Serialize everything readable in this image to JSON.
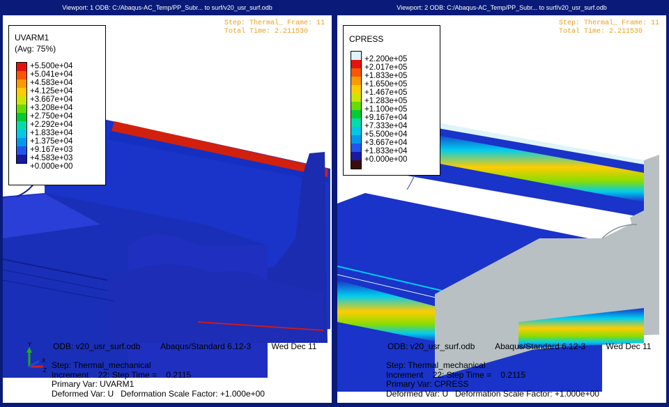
{
  "viewports": [
    {
      "title": "Viewport: 1    ODB: C:/Abaqus-AC_Temp/PP_Subr... to surf/v20_usr_surf.odb",
      "info": {
        "step_line": "Step: Thermal_ Frame: 11",
        "time_line": "Total Time: 2.211530"
      },
      "legend": {
        "title": "UVARM1",
        "subtitle": "(Avg: 75%)",
        "values": [
          "+5.500e+04",
          "+5.041e+04",
          "+4.583e+04",
          "+4.125e+04",
          "+3.667e+04",
          "+3.208e+04",
          "+2.750e+04",
          "+2.292e+04",
          "+1.833e+04",
          "+1.375e+04",
          "+9.167e+03",
          "+4.583e+03",
          "+0.000e+00"
        ]
      },
      "footer": {
        "odb": "ODB: v20_usr_surf.odb",
        "solver": "Abaqus/Standard 6.12-3",
        "date": "Wed Dec 11",
        "step": "Step: Thermal_mechanical",
        "increment": "Increment    22: Step Time =    0.2115",
        "primary": "Primary Var: UVARM1",
        "deformed": "Deformed Var: U   Deformation Scale Factor: +1.000e+00"
      }
    },
    {
      "title": "Viewport: 2    ODB: C:/Abaqus-AC_Temp/PP_Subr... to surf/v20_usr_surf.odb",
      "info": {
        "step_line": "Step: Thermal_ Frame: 11",
        "time_line": "Total Time: 2.211530"
      },
      "legend": {
        "title": "CPRESS",
        "subtitle": "",
        "values": [
          "+2.200e+05",
          "+2.017e+05",
          "+1.833e+05",
          "+1.650e+05",
          "+1.467e+05",
          "+1.283e+05",
          "+1.100e+05",
          "+9.167e+04",
          "+7.333e+04",
          "+5.500e+04",
          "+3.667e+04",
          "+1.833e+04",
          "+0.000e+00"
        ]
      },
      "footer": {
        "odb": "ODB: v20_usr_surf.odb",
        "solver": "Abaqus/Standard 6.12-3",
        "date": "Wed Dec 11",
        "step": "Step: Thermal_mechanical",
        "increment": "Increment    22: Step Time =    0.2115",
        "primary": "Primary Var: CPRESS",
        "deformed": "Deformed Var: U   Deformation Scale Factor: +1.000e+00"
      }
    }
  ],
  "triad_labels": {
    "y": "Y",
    "x": "X",
    "z": "Z"
  },
  "colors": {
    "background": "#0a1a78",
    "info_text": "#e8a020",
    "contour": [
      "#dff4f8",
      "#e6120c",
      "#ff5500",
      "#ff9900",
      "#ffcc00",
      "#cce600",
      "#66dd00",
      "#00cc33",
      "#00ddaa",
      "#00c8e6",
      "#0099ee",
      "#2255ee",
      "#1a1aa0",
      "#3a0d0d"
    ],
    "model_blue": "#1a33c8",
    "model_gray": "#b8c0c4"
  }
}
